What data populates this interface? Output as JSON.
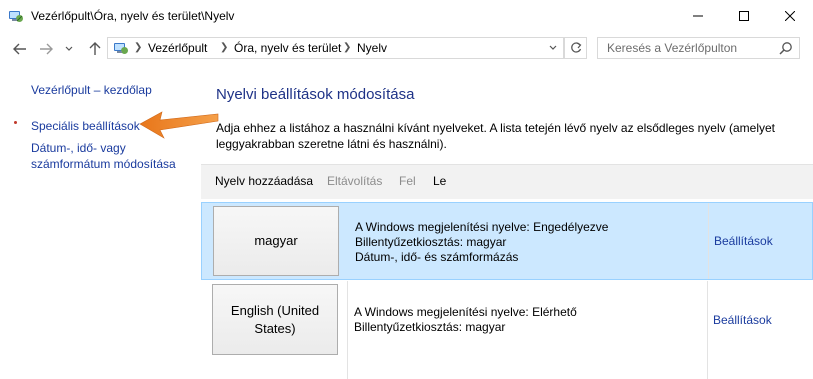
{
  "window": {
    "title": "Vezérlőpult\\Óra, nyelv és terület\\Nyelv"
  },
  "address": {
    "crumbs": [
      "Vezérlőpult",
      "Óra, nyelv és terület",
      "Nyelv"
    ],
    "search_placeholder": "Keresés a Vezérlőpulton"
  },
  "sidebar": {
    "home": "Vezérlőpult – kezdőlap",
    "advanced": "Speciális beállítások",
    "datetime_line1": "Dátum-, idő- vagy",
    "datetime_line2": "számformátum módosítása"
  },
  "main": {
    "heading": "Nyelvi beállítások módosítása",
    "description": "Adja ehhez a listához a használni kívánt nyelveket. A lista tetején lévő nyelv az elsődleges nyelv (amelyet leggyakrabban szeretne látni és használni).",
    "toolbar": {
      "add": "Nyelv hozzáadása",
      "remove": "Eltávolítás",
      "up": "Fel",
      "down": "Le"
    },
    "languages": [
      {
        "name": "magyar",
        "display": "A Windows megjelenítési nyelve: Engedélyezve",
        "keyboard": "Billentyűzetkiosztás: magyar",
        "formats": "Dátum-, idő- és számformázás",
        "settings": "Beállítások"
      },
      {
        "name_line1": "English (United",
        "name_line2": "States)",
        "display": "A Windows megjelenítési nyelve: Elérhető",
        "keyboard": "Billentyűzetkiosztás: magyar",
        "settings": "Beállítások"
      }
    ]
  },
  "colors": {
    "link": "#1a3b9e",
    "heading": "#1e3287",
    "selected_row": "#cce8ff",
    "annotation_arrow": "#f08a24"
  },
  "icons": [
    "control-panel-icon",
    "minimize-icon",
    "maximize-icon",
    "close-icon",
    "back-arrow-icon",
    "forward-arrow-icon",
    "recent-dropdown-icon",
    "up-arrow-icon",
    "chevron-right-icon",
    "refresh-icon",
    "search-icon"
  ]
}
